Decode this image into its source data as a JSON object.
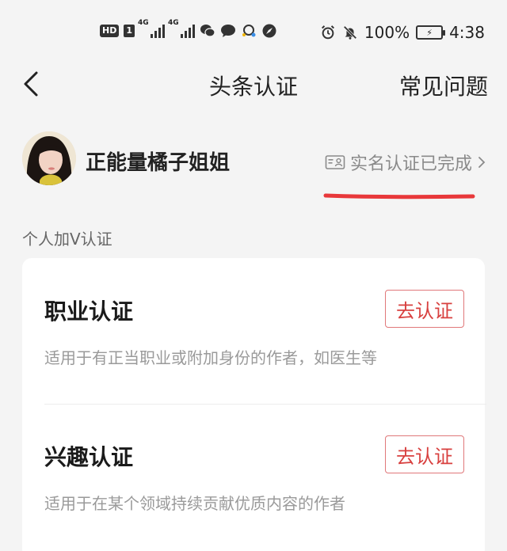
{
  "status_bar": {
    "hd_label": "HD",
    "sim_label": "1",
    "net1_label": "4G",
    "net2_label": "4G",
    "battery_percent": "100%",
    "battery_icon_label": "⚡",
    "time": "4:38",
    "icons": [
      "wechat-icon",
      "message-icon",
      "qq-icon",
      "compass-icon",
      "alarm-icon",
      "mute-bell-icon"
    ]
  },
  "header": {
    "title": "头条认证",
    "faq": "常见问题"
  },
  "profile": {
    "username": "正能量橘子姐姐",
    "verification_status": "实名认证已完成",
    "underline_color": "#e8383a"
  },
  "section": {
    "label": "个人加V认证"
  },
  "certifications": [
    {
      "title": "职业认证",
      "description": "适用于有正当职业或附加身份的作者，如医生等",
      "button": "去认证"
    },
    {
      "title": "兴趣认证",
      "description": "适用于在某个领域持续贡献优质内容的作者",
      "button": "去认证"
    }
  ],
  "colors": {
    "accent_red": "#d8403f",
    "button_border": "#e0787a",
    "background": "#f4f4f4"
  }
}
